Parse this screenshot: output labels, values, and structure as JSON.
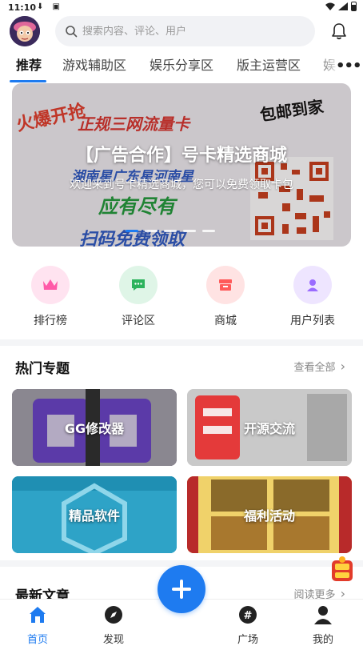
{
  "status_bar": {
    "time": "11:10"
  },
  "search": {
    "placeholder": "搜索内容、评论、用户"
  },
  "tabs": [
    {
      "label": "推荐"
    },
    {
      "label": "游戏辅助区"
    },
    {
      "label": "娱乐分享区"
    },
    {
      "label": "版主运营区"
    },
    {
      "label": "娱"
    }
  ],
  "banner": {
    "title": "【广告合作】号卡精选商城",
    "description": "欢迎来到号卡精选商城，您可以免费领取卡包",
    "art_text": [
      "正规三网流量卡",
      "湖南星广东星河南星",
      "应有尽有",
      "扫码免费领取",
      "包邮到家",
      "火爆开抢"
    ],
    "slide_count": 5,
    "active_slide": 1
  },
  "quick_links": [
    {
      "label": "排行榜",
      "icon": "crown-icon",
      "color": "#ff5aa8",
      "bg": "#ffe3f0"
    },
    {
      "label": "评论区",
      "icon": "comment-icon",
      "color": "#2db35d",
      "bg": "#dff5e7"
    },
    {
      "label": "商城",
      "icon": "shop-icon",
      "color": "#ff5a5a",
      "bg": "#ffe3e3"
    },
    {
      "label": "用户列表",
      "icon": "user-icon",
      "color": "#9a6bff",
      "bg": "#eee5ff"
    }
  ],
  "hot_topics": {
    "title": "热门专题",
    "more": "查看全部",
    "cards": [
      {
        "label": "GG修改器"
      },
      {
        "label": "开源交流"
      },
      {
        "label": "精品软件"
      },
      {
        "label": "福利活动"
      }
    ]
  },
  "latest": {
    "title": "最新文章",
    "more": "阅读更多"
  },
  "bottom_nav": [
    {
      "label": "首页"
    },
    {
      "label": "发现"
    },
    {
      "label": "广场"
    },
    {
      "label": "我的"
    }
  ],
  "colors": {
    "accent": "#1e7bf0"
  }
}
